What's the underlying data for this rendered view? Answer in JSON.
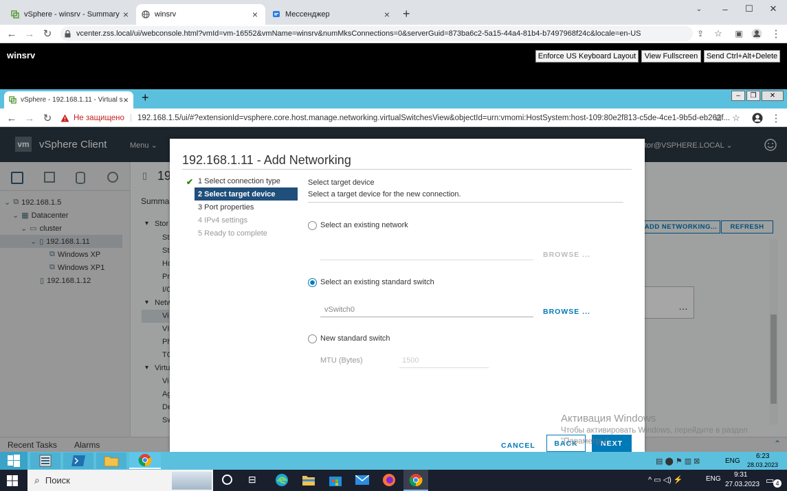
{
  "outer_browser": {
    "tabs": [
      {
        "title": "vSphere - winsrv - Summary",
        "icon": "vsphere-icon",
        "active": false
      },
      {
        "title": "winsrv",
        "icon": "globe-icon",
        "active": true
      },
      {
        "title": "Мессенджер",
        "icon": "messenger-icon",
        "active": false
      }
    ],
    "url": "vcenter.zss.local/ui/webconsole.html?vmId=vm-16552&vmName=winsrv&numMksConnections=0&serverGuid=873ba6c2-5a15-44a4-81b4-b7497968f24c&locale=en-US"
  },
  "console": {
    "title": "winsrv",
    "buttons": {
      "keyboard": "Enforce US Keyboard Layout",
      "fullscreen": "View Fullscreen",
      "ctrl_alt_del": "Send Ctrl+Alt+Delete"
    }
  },
  "inner_browser": {
    "tab_title": "vSphere - 192.168.1.11 - Virtual s",
    "security": "Не защищено",
    "url": "192.168.1.5/ui/#?extensionId=vsphere.core.host.manage.networking.virtualSwitchesView&objectId=urn:vmomi:HostSystem:host-109:80e2f813-c5de-4ce1-9b5d-eb262f..."
  },
  "vsphere": {
    "logo": "vm",
    "app_name": "vSphere Client",
    "menu_label": "Menu",
    "user": "tor@VSPHERE.LOCAL",
    "host_title": "19",
    "summary_tab": "Summa",
    "tree": [
      {
        "label": "192.168.1.5",
        "level": 0,
        "icon": "vcenter-icon"
      },
      {
        "label": "Datacenter",
        "level": 1,
        "icon": "datacenter-icon"
      },
      {
        "label": "cluster",
        "level": 2,
        "icon": "cluster-icon"
      },
      {
        "label": "192.168.1.11",
        "level": 3,
        "icon": "host-icon",
        "selected": true
      },
      {
        "label": "Windows XP",
        "level": 4,
        "icon": "vm-icon"
      },
      {
        "label": "Windows XP1",
        "level": 4,
        "icon": "vm-icon"
      },
      {
        "label": "192.168.1.12",
        "level": 3,
        "icon": "host-icon"
      }
    ],
    "sections": [
      "Stor",
      "Netw",
      "Virtu"
    ],
    "section_items": [
      "St",
      "St",
      "Ho",
      "Pr",
      "I/O",
      "Vi",
      "VI",
      "Ph",
      "TC",
      "Vi",
      "Ag",
      "De",
      "Sw"
    ],
    "add_networking": "ADD NETWORKING...",
    "refresh": "REFRESH",
    "recent_tasks": "Recent Tasks",
    "alarms": "Alarms"
  },
  "dialog": {
    "title": "192.168.1.11 - Add Networking",
    "steps": [
      {
        "label": "1 Select connection type",
        "state": "done"
      },
      {
        "label": "2 Select target device",
        "state": "active"
      },
      {
        "label": "3 Port properties",
        "state": "pending"
      },
      {
        "label": "4 IPv4 settings",
        "state": "disabled"
      },
      {
        "label": "5 Ready to complete",
        "state": "disabled"
      }
    ],
    "heading": "Select target device",
    "subheading": "Select a target device for the new connection.",
    "option_network": "Select an existing network",
    "browse_network": "BROWSE ...",
    "option_switch": "Select an existing standard switch",
    "switch_value": "vSwitch0",
    "browse_switch": "BROWSE ...",
    "option_new": "New standard switch",
    "mtu_label": "MTU (Bytes)",
    "mtu_placeholder": "1500",
    "selected_option": "switch",
    "cancel": "CANCEL",
    "back": "BACK",
    "next": "NEXT"
  },
  "activation": {
    "line1": "Активация Windows",
    "line2": "Чтобы активировать Windows, перейдите в раздел",
    "line3": "\"Параметры\"."
  },
  "vm_taskbar": {
    "lang": "ENG",
    "time": "6:23",
    "date": "28.03.2023"
  },
  "host_taskbar": {
    "search_placeholder": "Поиск",
    "lang": "ENG",
    "time": "9:31",
    "date": "27.03.2023",
    "notification_count": "4"
  },
  "colors": {
    "accent": "#0079b8",
    "step_active_bg": "#1f4f7a",
    "vm_taskbar": "#5bc0de",
    "vsphere_header": "#2b3a44"
  }
}
